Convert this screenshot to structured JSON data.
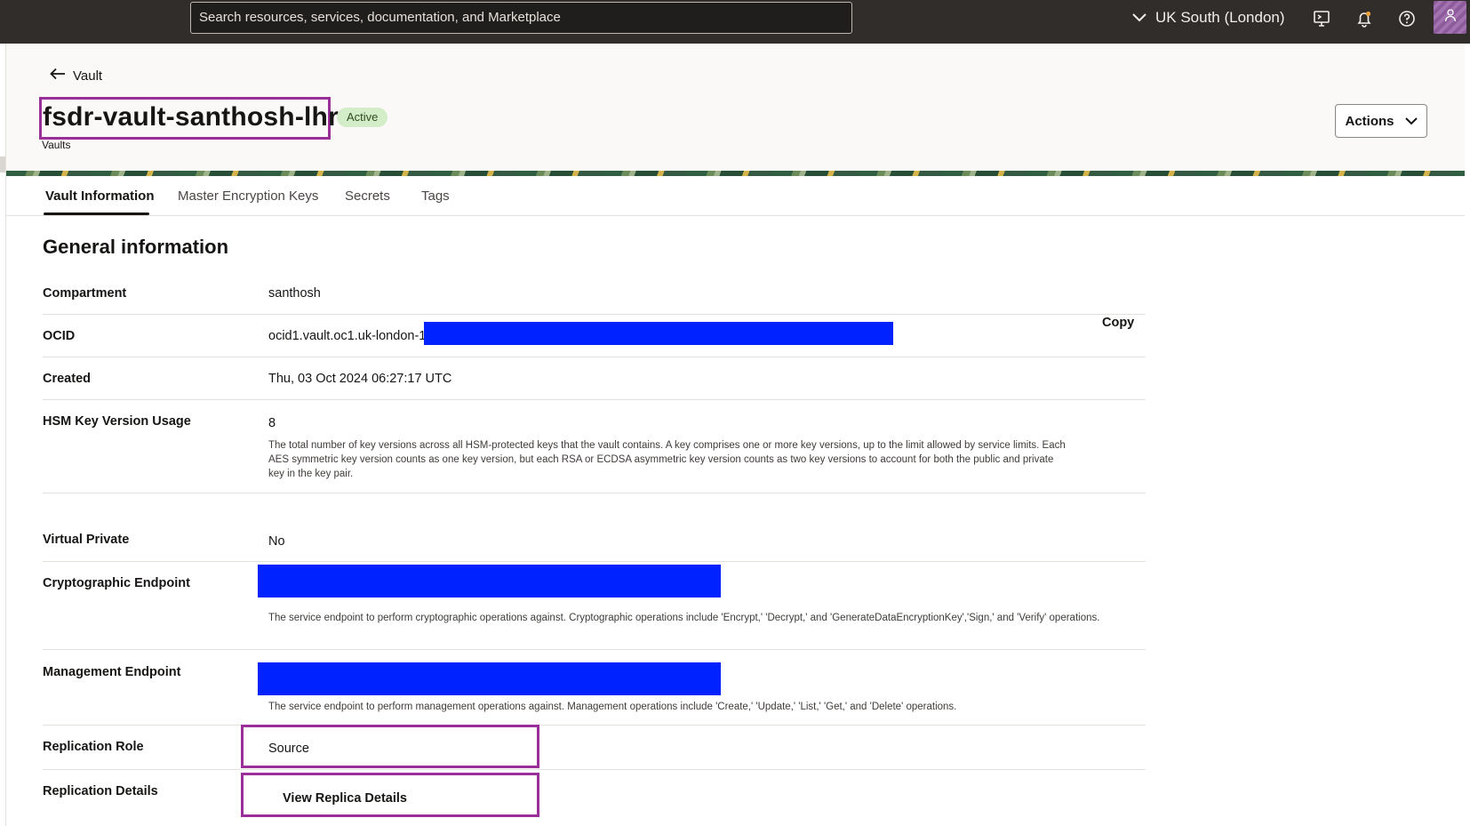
{
  "topbar": {
    "search_placeholder": "Search resources, services, documentation, and Marketplace",
    "region": "UK South (London)",
    "icons": [
      "chevron-down-icon",
      "cloud-shell-icon",
      "bell-icon",
      "help-icon",
      "user-icon"
    ]
  },
  "header": {
    "back_label": "Vault",
    "title": "fsdr-vault-santhosh-lhr",
    "status": "Active",
    "crumb": "Vaults",
    "actions_label": "Actions"
  },
  "tabs": [
    {
      "label": "Vault Information",
      "active": true
    },
    {
      "label": "Master Encryption Keys",
      "active": false
    },
    {
      "label": "Secrets",
      "active": false
    },
    {
      "label": "Tags",
      "active": false
    }
  ],
  "general": {
    "section_title": "General information",
    "compartment": {
      "label": "Compartment",
      "value": "santhosh"
    },
    "ocid": {
      "label": "OCID",
      "value": "ocid1.vault.oc1.uk-london-1",
      "copy_label": "Copy"
    },
    "created": {
      "label": "Created",
      "value": "Thu, 03 Oct 2024 06:27:17 UTC"
    },
    "hsm": {
      "label": "HSM Key Version Usage",
      "value": "8",
      "help": "The total number of key versions across all HSM-protected keys that the vault contains. A key comprises one or more key versions, up to the limit allowed by service limits. Each AES symmetric key version counts as one key version, but each RSA or ECDSA asymmetric key version counts as two key versions to account for both the public and private key in the key pair."
    },
    "virtual_private": {
      "label": "Virtual Private",
      "value": "No"
    },
    "crypto_endpoint": {
      "label": "Cryptographic Endpoint",
      "help": "The service endpoint to perform cryptographic operations against. Cryptographic operations include 'Encrypt,' 'Decrypt,' and 'GenerateDataEncryptionKey','Sign,' and 'Verify' operations."
    },
    "mgmt_endpoint": {
      "label": "Management Endpoint",
      "help": "The service endpoint to perform management operations against. Management operations include 'Create,' 'Update,' 'List,' 'Get,' and 'Delete' operations."
    },
    "replication_role": {
      "label": "Replication Role",
      "value": "Source"
    },
    "replication_details": {
      "label": "Replication Details",
      "link": "View Replica Details"
    }
  },
  "colors": {
    "topbar": "#312d2a",
    "highlight": "#9a2f9a",
    "redaction": "#0022ff",
    "active_badge": "#d4edc9"
  }
}
